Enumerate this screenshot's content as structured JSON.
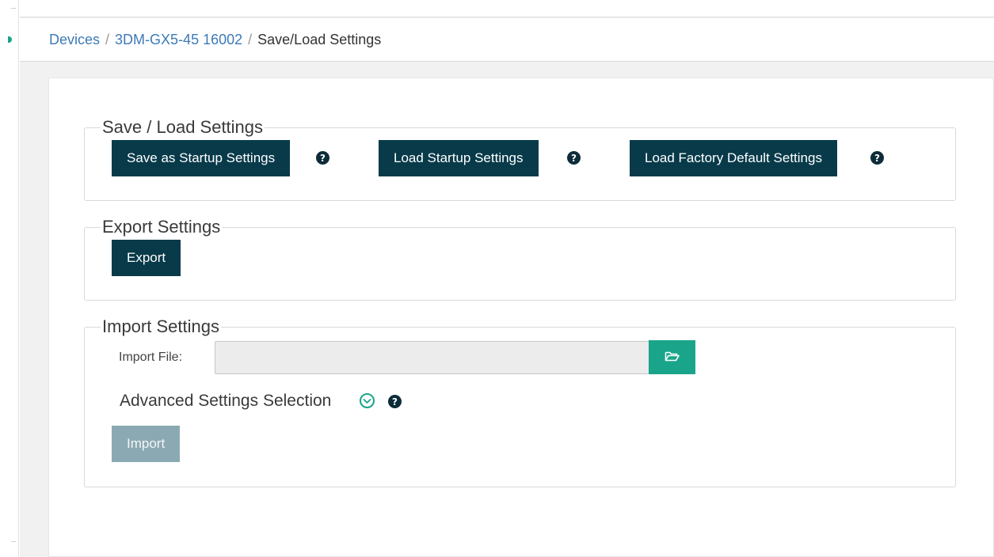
{
  "breadcrumb": {
    "items": [
      "Devices",
      "3DM-GX5-45 16002"
    ],
    "separator": "/",
    "current": "Save/Load Settings"
  },
  "save_load": {
    "legend": "Save / Load Settings",
    "save_startup_label": "Save as Startup Settings",
    "load_startup_label": "Load Startup Settings",
    "load_factory_label": "Load Factory Default Settings",
    "help_glyph": "?"
  },
  "export": {
    "legend": "Export Settings",
    "export_label": "Export"
  },
  "import": {
    "legend": "Import Settings",
    "file_label": "Import File:",
    "file_value": "",
    "browse_icon": "folder-open-icon",
    "advanced_label": "Advanced Settings Selection",
    "advanced_icon": "chevron-down-circle-icon",
    "import_label": "Import"
  },
  "colors": {
    "primary_button": "#083a4a",
    "disabled_button": "#8ba9b2",
    "accent": "#1aa58a",
    "link": "#3d7ab8"
  }
}
